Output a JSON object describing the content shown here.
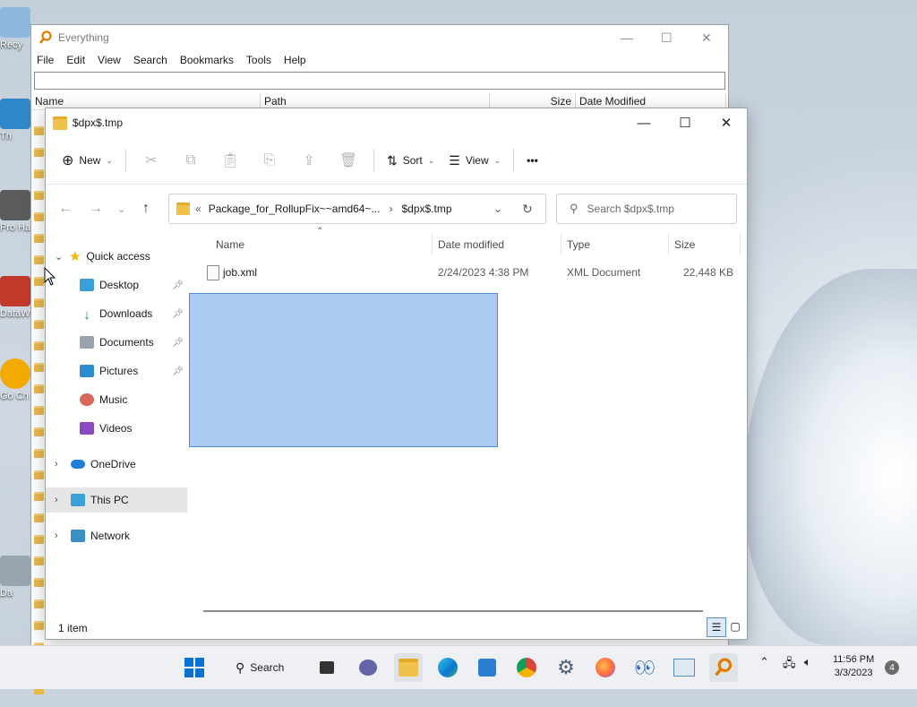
{
  "desktop": {
    "icons": [
      {
        "label": "Recy",
        "color": "#6fa8dc"
      },
      {
        "label": "Th",
        "color": "#3c8dc9"
      },
      {
        "label": "Pro Hac",
        "color": "#4a4a4a"
      },
      {
        "label": "DataW",
        "color": "#c0392b"
      },
      {
        "label": "Go Ch",
        "color": "#f2a900"
      },
      {
        "label": "Da",
        "color": "#9a9a9a"
      }
    ]
  },
  "everything": {
    "title": "Everything",
    "menu": [
      "File",
      "Edit",
      "View",
      "Search",
      "Bookmarks",
      "Tools",
      "Help"
    ],
    "search_value": "",
    "columns": [
      "Name",
      "Path",
      "Size",
      "Date Modified"
    ],
    "controls": {
      "minimize": "—",
      "maximize": "☐",
      "close": "✕"
    }
  },
  "explorer": {
    "title": "$dpx$.tmp",
    "controls": {
      "minimize": "—",
      "maximize": "☐",
      "close": "✕"
    },
    "toolbar": {
      "new_label": "New",
      "sort_label": "Sort",
      "view_label": "View",
      "more_label": "•••"
    },
    "address": {
      "prefix": "«",
      "crumb1": "Package_for_RollupFix~~amd64~...",
      "separator": "›",
      "crumb2": "$dpx$.tmp"
    },
    "search_placeholder": "Search $dpx$.tmp",
    "nav": {
      "quick_access": "Quick access",
      "desktop": "Desktop",
      "downloads": "Downloads",
      "documents": "Documents",
      "pictures": "Pictures",
      "music": "Music",
      "videos": "Videos",
      "onedrive": "OneDrive",
      "this_pc": "This PC",
      "network": "Network"
    },
    "columns": {
      "name": "Name",
      "date": "Date modified",
      "type": "Type",
      "size": "Size"
    },
    "files": [
      {
        "name": "job.xml",
        "date": "2/24/2023 4:38 PM",
        "type": "XML Document",
        "size": "22,448 KB"
      }
    ],
    "status": "1 item"
  },
  "taskbar": {
    "search_label": "Search",
    "time": "11:56 PM",
    "date": "3/3/2023",
    "notifications": "4"
  },
  "colors": {
    "selection": "#a9ccf0",
    "accent": "#0067c0",
    "folder": "#f0c14b"
  }
}
